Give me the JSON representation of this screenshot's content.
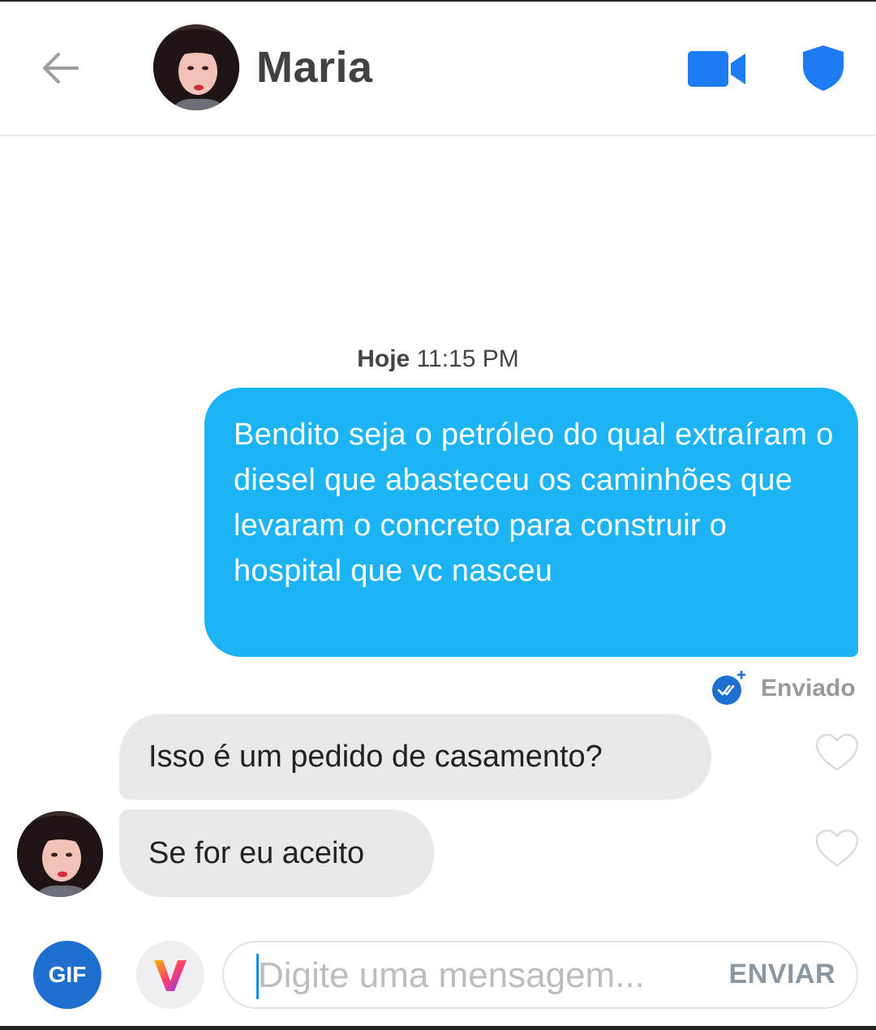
{
  "header": {
    "contact_name": "Maria",
    "back_icon": "arrow-left-icon",
    "video_icon": "video-camera-icon",
    "shield_icon": "shield-icon"
  },
  "conversation": {
    "timestamp_day": "Hoje",
    "timestamp_time": "11:15 PM",
    "sent_message": "Bendito seja o petróleo do qual extraíram o diesel que abasteceu os caminhões que levaram o concreto para construir o hospital que vc nasceu",
    "sent_status": "Enviado",
    "received_messages": [
      {
        "text": "Isso é um pedido de casamento?"
      },
      {
        "text": "Se for eu aceito"
      }
    ]
  },
  "composer": {
    "gif_label": "GIF",
    "placeholder": "Digite uma mensagem...",
    "send_label": "ENVIAR"
  },
  "colors": {
    "accent": "#1cb4f5",
    "brand_blue": "#1f6fd1",
    "received_bubble": "#e9e9e9"
  }
}
